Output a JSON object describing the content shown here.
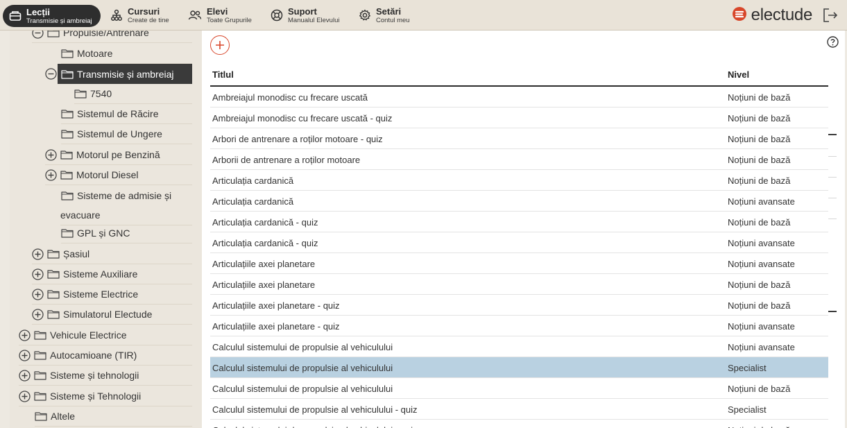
{
  "nav": {
    "items": [
      {
        "title": "Lecții",
        "subtitle": "Transmisie și ambreiaj",
        "icon": "lessons-icon"
      },
      {
        "title": "Cursuri",
        "subtitle": "Create de tine",
        "icon": "courses-icon"
      },
      {
        "title": "Elevi",
        "subtitle": "Toate Grupurile",
        "icon": "students-icon"
      },
      {
        "title": "Suport",
        "subtitle": "Manualul Elevului",
        "icon": "support-icon"
      },
      {
        "title": "Setări",
        "subtitle": "Contul meu",
        "icon": "settings-icon"
      }
    ],
    "brand": "electude"
  },
  "tree": {
    "items": [
      {
        "label": "Propulsie/Antrenare",
        "toggle": "minus"
      },
      {
        "label": "Motoare",
        "toggle": "none"
      },
      {
        "label": "Transmisie și ambreiaj",
        "toggle": "minus",
        "selected": true
      },
      {
        "label": "7540",
        "toggle": "none"
      },
      {
        "label": "Sistemul de Răcire",
        "toggle": "none"
      },
      {
        "label": "Sistemul de Ungere",
        "toggle": "none"
      },
      {
        "label": "Motorul pe Benzină",
        "toggle": "plus"
      },
      {
        "label": "Motorul Diesel",
        "toggle": "plus"
      },
      {
        "label": "Sisteme de admisie și",
        "toggle": "none"
      },
      {
        "label": "evacuare",
        "toggle": "none"
      },
      {
        "label": "GPL și GNC",
        "toggle": "none"
      },
      {
        "label": "Șasiul",
        "toggle": "plus"
      },
      {
        "label": "Sisteme Auxiliare",
        "toggle": "plus"
      },
      {
        "label": "Sisteme Electrice",
        "toggle": "plus"
      },
      {
        "label": "Simulatorul Electude",
        "toggle": "plus"
      },
      {
        "label": "Vehicule Electrice",
        "toggle": "plus"
      },
      {
        "label": "Autocamioane (TIR)",
        "toggle": "plus"
      },
      {
        "label": "Sisteme și tehnologii",
        "toggle": "plus"
      },
      {
        "label": "Sisteme și Tehnologii",
        "toggle": "plus"
      },
      {
        "label": "Altele",
        "toggle": "none"
      }
    ]
  },
  "table": {
    "headers": {
      "title": "Titlul",
      "level": "Nivel"
    },
    "rows": [
      {
        "title": "Ambreiajul monodisc cu frecare uscată",
        "level": "Noțiuni de bază"
      },
      {
        "title": "Ambreiajul monodisc cu frecare uscată - quiz",
        "level": "Noțiuni de bază"
      },
      {
        "title": "Arbori de antrenare a roților motoare - quiz",
        "level": "Noțiuni de bază"
      },
      {
        "title": "Arborii de antrenare a roților motoare",
        "level": "Noțiuni de bază"
      },
      {
        "title": "Articulația cardanică",
        "level": "Noțiuni de bază"
      },
      {
        "title": "Articulația cardanică",
        "level": "Noțiuni avansate"
      },
      {
        "title": "Articulația cardanică - quiz",
        "level": "Noțiuni de bază"
      },
      {
        "title": "Articulația cardanică - quiz",
        "level": "Noțiuni avansate"
      },
      {
        "title": "Articulațiile axei planetare",
        "level": "Noțiuni avansate"
      },
      {
        "title": "Articulațiile axei planetare",
        "level": "Noțiuni de bază"
      },
      {
        "title": "Articulațiile axei planetare - quiz",
        "level": "Noțiuni de bază"
      },
      {
        "title": "Articulațiile axei planetare - quiz",
        "level": "Noțiuni avansate"
      },
      {
        "title": "Calculul sistemului de propulsie al vehiculului",
        "level": "Noțiuni avansate"
      },
      {
        "title": "Calculul sistemului de propulsie al vehiculului",
        "level": "Specialist",
        "highlighted": true
      },
      {
        "title": "Calculul sistemului de propulsie al vehiculului",
        "level": "Noțiuni de bază"
      },
      {
        "title": "Calculul sistemului de propulsie al vehiculului - quiz",
        "level": "Specialist"
      },
      {
        "title": "Calculul sistemului de propulsie al vehiculului - quiz",
        "level": "Noțiuni de bază"
      }
    ]
  },
  "colors": {
    "accent": "#d8472b",
    "topbar": "#e9e3d8",
    "sidebar": "#ebe6dd",
    "selected_tree": "#3a3a3a",
    "highlight_row": "#b9d1e1"
  }
}
